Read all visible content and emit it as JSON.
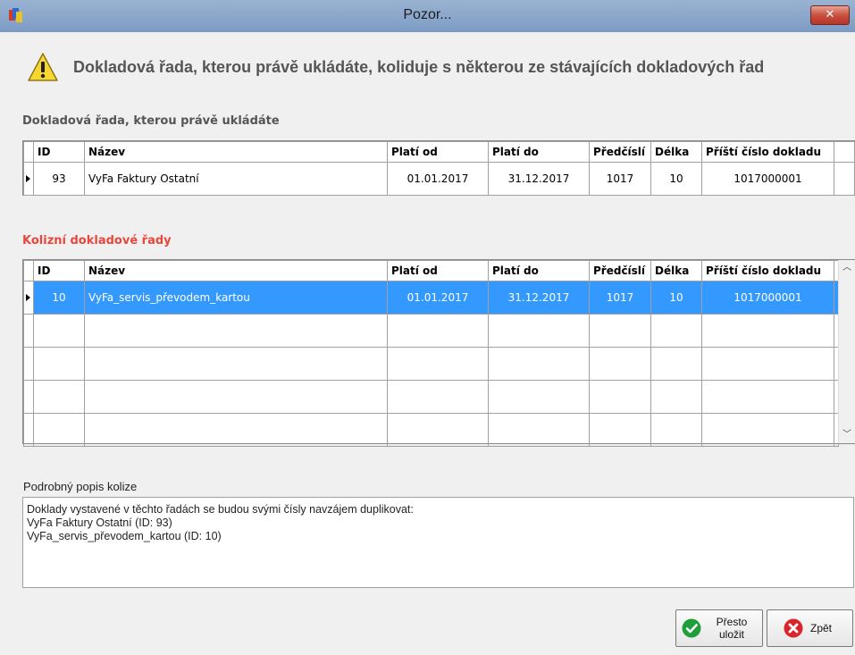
{
  "window": {
    "title": "Pozor...",
    "close_label": "✕"
  },
  "header": {
    "message": "Dokladová řada, kterou právě ukládáte, koliduje s některou ze stávajících dokladových řad"
  },
  "current_section": {
    "label": "Dokladová řada, kterou právě ukládáte",
    "columns": [
      "ID",
      "Název",
      "Platí od",
      "Platí do",
      "Předčíslí",
      "Délka",
      "Příští číslo dokladu"
    ],
    "rows": [
      {
        "id": "93",
        "name": "VyFa Faktury Ostatní",
        "from": "01.01.2017",
        "to": "31.12.2017",
        "prefix": "1017",
        "length": "10",
        "next": "1017000001"
      }
    ]
  },
  "conflict_section": {
    "label": "Kolizní dokladové řady",
    "columns": [
      "ID",
      "Název",
      "Platí od",
      "Platí do",
      "Předčíslí",
      "Délka",
      "Příští číslo dokladu"
    ],
    "rows": [
      {
        "id": "10",
        "name": "VyFa_servis_převodem_kartou",
        "from": "01.01.2017",
        "to": "31.12.2017",
        "prefix": "1017",
        "length": "10",
        "next": "1017000001"
      }
    ]
  },
  "description": {
    "label": "Podrobný popis kolize",
    "lines": [
      "Doklady vystavené v těchto řadách se budou svými čísly navzájem duplikovat:",
      "VyFa Faktury Ostatní (ID: 93)",
      "VyFa_servis_převodem_kartou (ID: 10)"
    ]
  },
  "buttons": {
    "save_line1": "Přesto",
    "save_line2": "uložit",
    "back": "Zpět"
  },
  "colors": {
    "selection": "#3399ff",
    "conflict_label": "#e8473c",
    "save_icon": "#1f9e3a",
    "back_icon": "#d9262b"
  }
}
